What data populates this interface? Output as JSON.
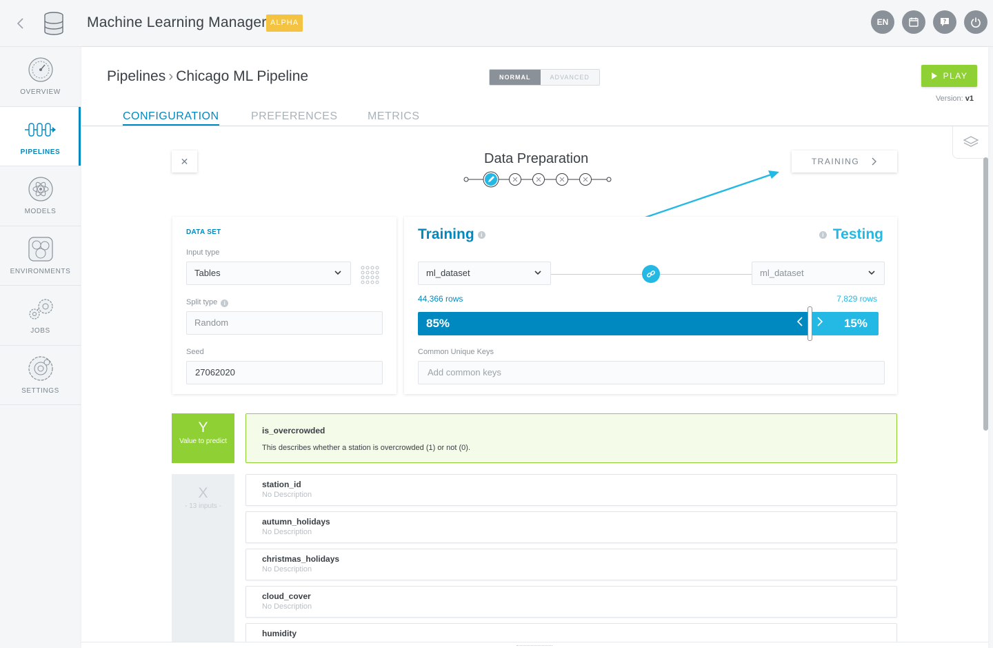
{
  "app": {
    "title": "Machine Learning Manager",
    "badge": "ALPHA"
  },
  "top_actions": [
    {
      "label": "EN",
      "icon": "language"
    },
    {
      "label": "",
      "icon": "calendar-icon"
    },
    {
      "label": "",
      "icon": "help-chat-icon"
    },
    {
      "label": "",
      "icon": "power-icon"
    }
  ],
  "sidebar": {
    "items": [
      {
        "label": "OVERVIEW",
        "icon": "gauge-icon",
        "active": false
      },
      {
        "label": "PIPELINES",
        "icon": "pipeline-icon",
        "active": true
      },
      {
        "label": "MODELS",
        "icon": "atom-icon",
        "active": false
      },
      {
        "label": "ENVIRONMENTS",
        "icon": "environment-icon",
        "active": false
      },
      {
        "label": "JOBS",
        "icon": "gears-icon",
        "active": false
      },
      {
        "label": "SETTINGS",
        "icon": "settings-gear-icon",
        "active": false
      }
    ]
  },
  "header": {
    "breadcrumb_root": "Pipelines",
    "breadcrumb_current": "Chicago ML Pipeline",
    "mode_normal": "NORMAL",
    "mode_advanced": "ADVANCED",
    "play_label": "PLAY",
    "version_label": "Version:",
    "version_value": "v1"
  },
  "tabs": [
    {
      "label": "CONFIGURATION",
      "active": true
    },
    {
      "label": "PREFERENCES",
      "active": false
    },
    {
      "label": "METRICS",
      "active": false
    }
  ],
  "wizard": {
    "step_title": "Data Preparation",
    "next_label": "TRAINING",
    "steps_total": 5,
    "current_step": 1
  },
  "dataset": {
    "section_title": "DATA SET",
    "input_type_label": "Input type",
    "input_type_value": "Tables",
    "split_type_label": "Split type",
    "split_type_value": "Random",
    "seed_label": "Seed",
    "seed_value": "27062020"
  },
  "split": {
    "training_title": "Training",
    "testing_title": "Testing",
    "training_dataset": "ml_dataset",
    "testing_dataset": "ml_dataset",
    "training_rows": "44,366 rows",
    "testing_rows": "7,829 rows",
    "training_pct_label": "85%",
    "testing_pct_label": "15%",
    "training_fraction": 0.85,
    "common_keys_label": "Common Unique Keys",
    "common_keys_placeholder": "Add common keys"
  },
  "target": {
    "letter": "Y",
    "caption": "Value to predict",
    "name": "is_overcrowded",
    "description": "This describes whether a station is overcrowded (1) or not (0)."
  },
  "inputs": {
    "letter": "X",
    "caption": "- 13 inputs -",
    "items": [
      {
        "name": "station_id",
        "description": "No Description"
      },
      {
        "name": "autumn_holidays",
        "description": "No Description"
      },
      {
        "name": "christmas_holidays",
        "description": "No Description"
      },
      {
        "name": "cloud_cover",
        "description": "No Description"
      },
      {
        "name": "humidity",
        "description": ""
      }
    ]
  },
  "colors": {
    "primary": "#0089c0",
    "secondary": "#24b8e4",
    "success": "#8fd135",
    "badge": "#f5c342"
  }
}
